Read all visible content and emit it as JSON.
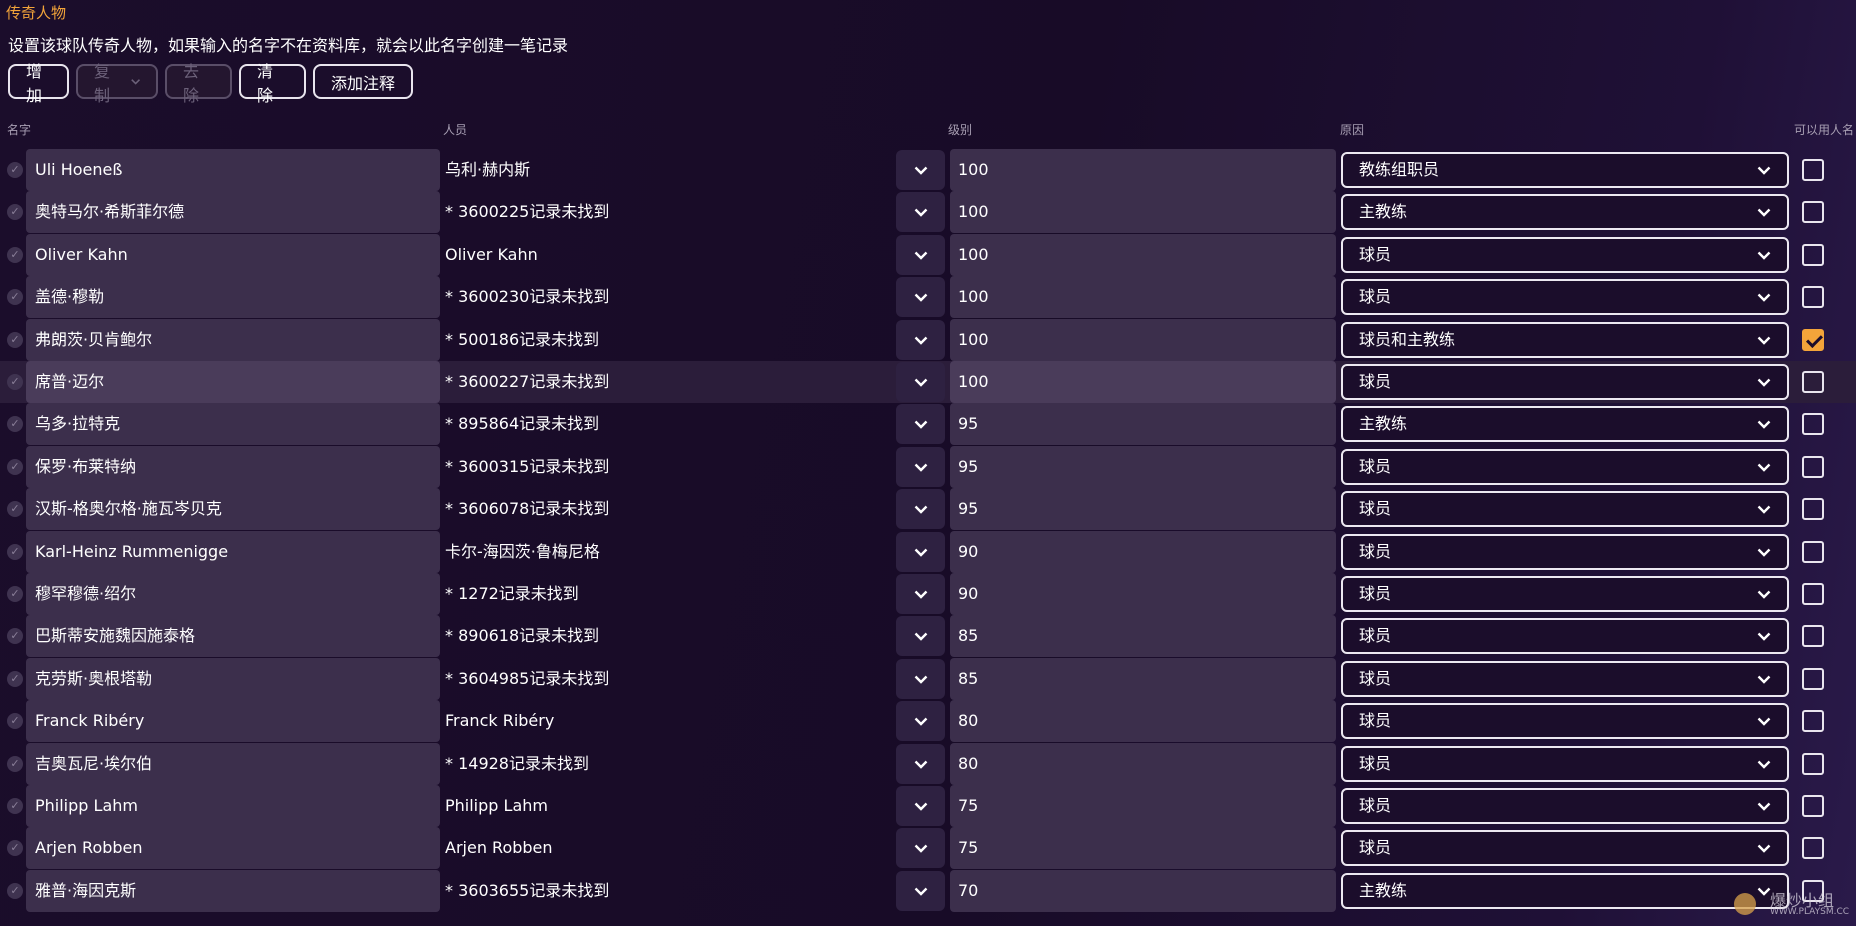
{
  "title": "传奇人物",
  "description": "设置该球队传奇人物，如果输入的名字不在资料库，就会以此名字创建一笔记录",
  "toolbar": {
    "add": "增加",
    "copy": "复制",
    "remove": "去除",
    "clear": "清除",
    "add_note": "添加注释"
  },
  "headers": {
    "name": "名字",
    "person": "人员",
    "level": "级别",
    "reason": "原因",
    "usable": "可以用人名"
  },
  "rows": [
    {
      "name": "Uli Hoeneß",
      "person": "乌利·赫内斯",
      "level": "100",
      "reason": "教练组职员",
      "checked": false
    },
    {
      "name": "奥特马尔·希斯菲尔德",
      "person": "* 3600225记录未找到",
      "level": "100",
      "reason": "主教练",
      "checked": false
    },
    {
      "name": "Oliver Kahn",
      "person": "Oliver Kahn",
      "level": "100",
      "reason": "球员",
      "checked": false
    },
    {
      "name": "盖德·穆勒",
      "person": "* 3600230记录未找到",
      "level": "100",
      "reason": "球员",
      "checked": false
    },
    {
      "name": "弗朗茨·贝肯鲍尔",
      "person": "* 500186记录未找到",
      "level": "100",
      "reason": "球员和主教练",
      "checked": true
    },
    {
      "name": "席普·迈尔",
      "person": "* 3600227记录未找到",
      "level": "100",
      "reason": "球员",
      "checked": false
    },
    {
      "name": "乌多·拉特克",
      "person": "* 895864记录未找到",
      "level": "95",
      "reason": "主教练",
      "checked": false
    },
    {
      "name": "保罗·布莱特纳",
      "person": "* 3600315记录未找到",
      "level": "95",
      "reason": "球员",
      "checked": false
    },
    {
      "name": "汉斯-格奥尔格·施瓦岑贝克",
      "person": "* 3606078记录未找到",
      "level": "95",
      "reason": "球员",
      "checked": false
    },
    {
      "name": "Karl-Heinz Rummenigge",
      "person": "卡尔-海因茨·鲁梅尼格",
      "level": "90",
      "reason": "球员",
      "checked": false
    },
    {
      "name": "穆罕穆德·绍尔",
      "person": "* 1272记录未找到",
      "level": "90",
      "reason": "球员",
      "checked": false
    },
    {
      "name": "巴斯蒂安施魏因施泰格",
      "person": "* 890618记录未找到",
      "level": "85",
      "reason": "球员",
      "checked": false
    },
    {
      "name": "克劳斯·奥根塔勒",
      "person": "* 3604985记录未找到",
      "level": "85",
      "reason": "球员",
      "checked": false
    },
    {
      "name": "Franck Ribéry",
      "person": "Franck Ribéry",
      "level": "80",
      "reason": "球员",
      "checked": false
    },
    {
      "name": "吉奥瓦尼·埃尔伯",
      "person": "* 14928记录未找到",
      "level": "80",
      "reason": "球员",
      "checked": false
    },
    {
      "name": "Philipp Lahm",
      "person": "Philipp Lahm",
      "level": "75",
      "reason": "球员",
      "checked": false
    },
    {
      "name": "Arjen Robben",
      "person": "Arjen Robben",
      "level": "75",
      "reason": "球员",
      "checked": false
    },
    {
      "name": "雅普·海因克斯",
      "person": "* 3603655记录未找到",
      "level": "70",
      "reason": "主教练",
      "checked": false
    }
  ],
  "watermark": {
    "text": "爆炒小组",
    "sub": "WWW.PLAYSM.CC"
  },
  "colors": {
    "accent": "#f3a43a",
    "background": "#1b0d2b",
    "field": "#3c2f4c"
  }
}
